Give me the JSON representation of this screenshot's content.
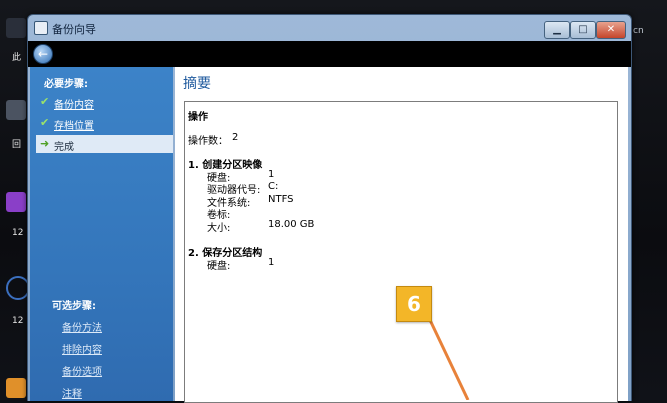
{
  "window": {
    "title": "备份向导",
    "controls": {
      "minimize": "▁",
      "maximize": "□",
      "close": "✕"
    }
  },
  "desktop": {
    "labels": [
      "此",
      "回",
      "12",
      "12",
      "cn"
    ]
  },
  "sidebar": {
    "required_heading": "必要步骤:",
    "required_items": [
      {
        "label": "备份内容",
        "done": true,
        "active": false
      },
      {
        "label": "存档位置",
        "done": true,
        "active": false
      },
      {
        "label": "完成",
        "done": false,
        "active": true
      }
    ],
    "optional_heading": "可选步骤:",
    "optional_items": [
      "备份方法",
      "排除内容",
      "备份选项",
      "注释"
    ]
  },
  "main": {
    "title": "摘要",
    "section_heading": "操作",
    "op_count_label": "操作数：",
    "op_count": "2",
    "op1": {
      "heading": "1.  创建分区映像",
      "rows": [
        {
          "k": "硬盘:",
          "v": "1"
        },
        {
          "k": "驱动器代号:",
          "v": "C:"
        },
        {
          "k": "文件系统:",
          "v": "NTFS"
        },
        {
          "k": "卷标:",
          "v": ""
        },
        {
          "k": "大小:",
          "v": "18.00 GB"
        }
      ]
    },
    "op2": {
      "heading": "2.  保存分区结构",
      "rows": [
        {
          "k": "硬盘:",
          "v": "1"
        }
      ]
    }
  },
  "annotation": {
    "number": "6",
    "color": "#f3b628"
  }
}
